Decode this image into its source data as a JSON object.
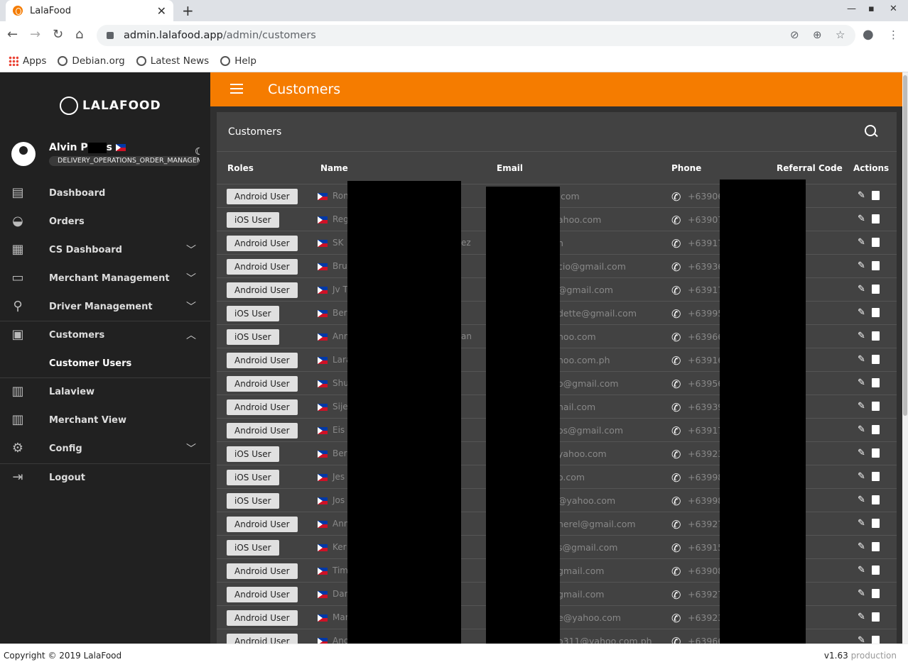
{
  "browser": {
    "tab_title": "LalaFood",
    "url_host": "admin.lalafood.app",
    "url_path": "/admin/customers",
    "bookmarks": [
      "Apps",
      "Debian.org",
      "Latest News",
      "Help"
    ]
  },
  "sidebar": {
    "logo": "LALAFOOD",
    "user_name": "Alvin P",
    "user_name_suffix": "s",
    "role": "DELIVERY_OPERATIONS_ORDER_MANAGEMENT",
    "items": [
      {
        "label": "Dashboard",
        "icon": "dashboard-icon"
      },
      {
        "label": "Orders",
        "icon": "basket-icon"
      },
      {
        "label": "CS Dashboard",
        "icon": "grid-icon"
      },
      {
        "label": "Merchant Management",
        "icon": "store-icon"
      },
      {
        "label": "Driver Management",
        "icon": "bike-icon"
      },
      {
        "label": "Customers",
        "icon": "contacts-icon"
      },
      {
        "label": "Customer Users"
      },
      {
        "label": "Lalaview",
        "icon": "map-icon"
      },
      {
        "label": "Merchant View",
        "icon": "map-icon"
      },
      {
        "label": "Config",
        "icon": "gear-icon"
      },
      {
        "label": "Logout",
        "icon": "logout-icon"
      }
    ]
  },
  "header": {
    "title": "Customers"
  },
  "card": {
    "title": "Customers"
  },
  "table": {
    "columns": [
      "Roles",
      "Name",
      "Email",
      "Phone",
      "Referral Code",
      "Actions"
    ],
    "rows": [
      {
        "role": "Android User",
        "name": "Ron",
        "email": ".com",
        "phone": "+63906"
      },
      {
        "role": "iOS User",
        "name": "Reg",
        "email": "ahoo.com",
        "phone": "+63907"
      },
      {
        "role": "Android User",
        "name": "SK",
        "name_tail": "ez",
        "email": "n",
        "phone": "+63917"
      },
      {
        "role": "Android User",
        "name": "Bru",
        "email": "cio@gmail.com",
        "phone": "+63936"
      },
      {
        "role": "Android User",
        "name": "Jv T",
        "email": "@gmail.com",
        "phone": "+63917"
      },
      {
        "role": "iOS User",
        "name": "Ber",
        "email": "dette@gmail.com",
        "phone": "+63995"
      },
      {
        "role": "iOS User",
        "name": "Ann",
        "name_tail": "an",
        "email": "hoo.com",
        "phone": "+63966"
      },
      {
        "role": "Android User",
        "name": "Lara",
        "email": "hoo.com.ph",
        "phone": "+63916"
      },
      {
        "role": "Android User",
        "name": "Shu",
        "email": "o@gmail.com",
        "phone": "+63956"
      },
      {
        "role": "Android User",
        "name": "Sije",
        "email": "nail.com",
        "phone": "+63939"
      },
      {
        "role": "Android User",
        "name": "Eis",
        "email": "os@gmail.com",
        "phone": "+63917"
      },
      {
        "role": "iOS User",
        "name": "Ber",
        "email": "yahoo.com",
        "phone": "+63923"
      },
      {
        "role": "iOS User",
        "name": "Jes",
        "email": "o.com",
        "phone": "+63998"
      },
      {
        "role": "iOS User",
        "name": "Jos",
        "email": "@yahoo.com",
        "phone": "+63998"
      },
      {
        "role": "Android User",
        "name": "Ann",
        "email": "herel@gmail.com",
        "phone": "+63927"
      },
      {
        "role": "iOS User",
        "name": "Ker",
        "email": "s@gmail.com",
        "phone": "+63915"
      },
      {
        "role": "Android User",
        "name": "Tim",
        "email": "gmail.com",
        "phone": "+63908"
      },
      {
        "role": "Android User",
        "name": "Dar",
        "email": "gmail.com",
        "phone": "+63927"
      },
      {
        "role": "Android User",
        "name": "Mar",
        "email": "e@yahoo.com",
        "phone": "+63923"
      },
      {
        "role": "Android User",
        "name": "And",
        "email": "o311@yahoo.com.ph",
        "phone": "+63966"
      }
    ]
  },
  "footer": {
    "copyright": "Copyright © 2019 LalaFood",
    "version": "v1.63",
    "env": "production"
  }
}
